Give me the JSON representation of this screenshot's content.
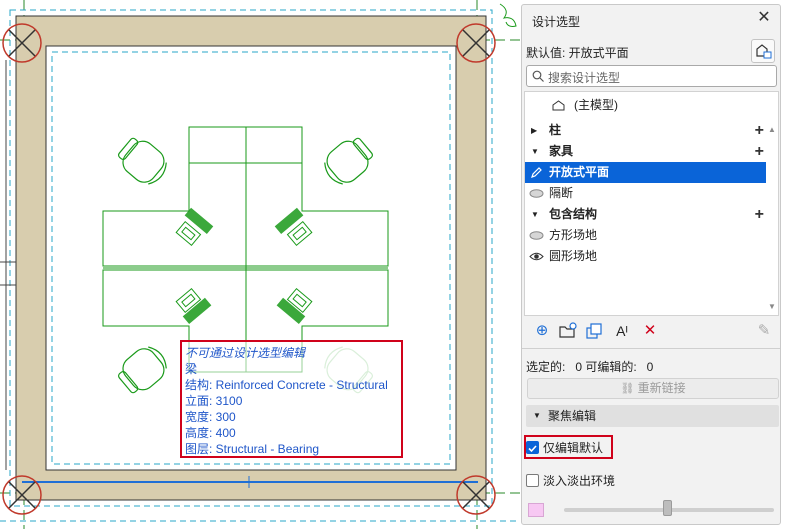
{
  "tooltip": {
    "title": "不可通过设计选型编辑",
    "lines": [
      "梁",
      "结构: Reinforced Concrete - Structural",
      "立面: 3100",
      "宽度: 300",
      "高度: 400",
      "图层: Structural - Bearing"
    ]
  },
  "panel": {
    "title": "设计选型",
    "default_label": "默认值: 开放式平面",
    "search_placeholder": "搜索设计选型",
    "main_model": "(主模型)",
    "items": [
      {
        "label": "柱",
        "kind": "group",
        "expander": "▶"
      },
      {
        "label": "家具",
        "kind": "group",
        "expander": "▼"
      },
      {
        "label": "开放式平面",
        "kind": "option",
        "state": "editing"
      },
      {
        "label": "隔断",
        "kind": "option",
        "state": "hidden"
      },
      {
        "label": "包含结构",
        "kind": "group",
        "expander": "▼"
      },
      {
        "label": "方形场地",
        "kind": "option",
        "state": "hidden"
      },
      {
        "label": "圆形场地",
        "kind": "option",
        "state": "visible"
      }
    ],
    "selected_status": "选定的:   0 可编辑的:   0",
    "relink_label": "重新链接",
    "focus_section": "聚焦编辑",
    "only_edit_default": "仅编辑默认",
    "fade_environment": "淡入淡出环境",
    "only_edit_default_checked": true,
    "fade_environment_checked": false,
    "fade_level": 0.62,
    "swatch_color": "#f7c8f3"
  },
  "colors": {
    "accent": "#0a64d8",
    "highlight_border": "#d0021b",
    "furniture": "#1a9a1a",
    "wall_fill": "#d8cdae",
    "tooltip_text": "#1f56c9"
  }
}
